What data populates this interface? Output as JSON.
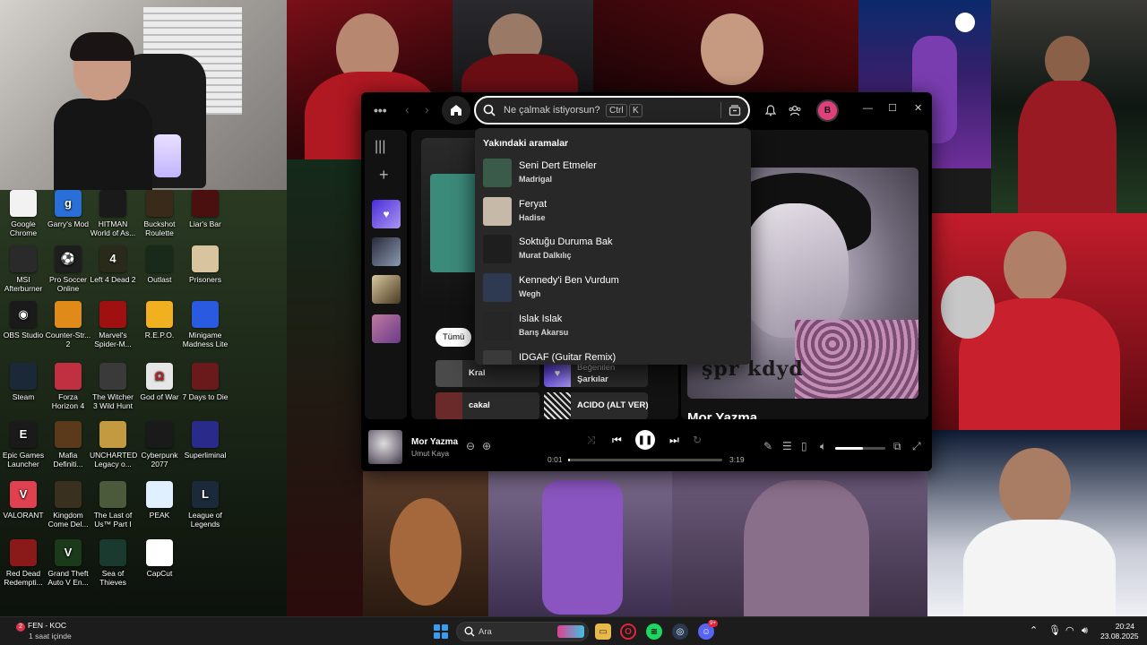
{
  "spotify": {
    "search": {
      "placeholder": "Ne çalmak istiyorsun?",
      "kbd1": "Ctrl",
      "kbd2": "K"
    },
    "avatar_letter": "B",
    "recent_header": "Yakındaki aramalar",
    "recent": [
      {
        "title": "Seni Dert Etmeler",
        "artist": "Madrigal",
        "color": "#3a5a4a"
      },
      {
        "title": "Feryat",
        "artist": "Hadise",
        "color": "#c7b9a8"
      },
      {
        "title": "Soktuğu Duruma Bak",
        "artist": "Murat Dalkılıç",
        "color": "#1e1e1e"
      },
      {
        "title": "Kennedy'i Ben Vurdum",
        "artist": "Wegh",
        "color": "#2e3a52"
      },
      {
        "title": "Islak Islak",
        "artist": "Barış Akarsu",
        "color": "#262626"
      },
      {
        "title": "IDGAF (Guitar Remix)",
        "artist": "",
        "color": "#3a3a3a"
      }
    ],
    "filter_chip": "Tümü",
    "cards": [
      {
        "label": "Kral",
        "color": "#4a4a4a"
      },
      {
        "label": "Beğenilen",
        "label2": "Şarkılar",
        "color": "#6c4bd8"
      },
      {
        "label": "cakal",
        "color": "#6a2a2a"
      },
      {
        "label": "ACIDO (ALT VER)",
        "color": "#3a3a3a"
      }
    ],
    "now_playing_title": "Mor Yazma",
    "cover_tag": "şpr kdyd",
    "player": {
      "title": "Mor Yazma",
      "artist": "Umut Kaya",
      "elapsed": "0:01",
      "duration": "3:19",
      "progress_fraction": 0.01,
      "volume_fraction": 0.55
    },
    "accent_color": "#1ed760"
  },
  "desktop_icons": [
    {
      "label": "Google Chrome",
      "bg": "#f2f2f2",
      "glyph": "",
      "col": 0,
      "row": 0
    },
    {
      "label": "Garry's Mod",
      "bg": "#2a6fd8",
      "glyph": "g",
      "col": 1,
      "row": 0
    },
    {
      "label": "HITMAN World of As...",
      "bg": "#1a1a1a",
      "glyph": "",
      "col": 2,
      "row": 0
    },
    {
      "label": "Buckshot Roulette",
      "bg": "#3a2a1a",
      "glyph": "",
      "col": 3,
      "row": 0
    },
    {
      "label": "Liar's Bar",
      "bg": "#4a1010",
      "glyph": "",
      "col": 4,
      "row": 0
    },
    {
      "label": "MSI Afterburner",
      "bg": "#2a2a2a",
      "glyph": "",
      "col": 0,
      "row": 1
    },
    {
      "label": "Pro Soccer Online",
      "bg": "#1e1e1e",
      "glyph": "⚽",
      "col": 1,
      "row": 1
    },
    {
      "label": "Left 4 Dead 2",
      "bg": "#2a2a1a",
      "glyph": "4",
      "col": 2,
      "row": 1
    },
    {
      "label": "Outlast",
      "bg": "#1a2a1a",
      "glyph": "",
      "col": 3,
      "row": 1
    },
    {
      "label": "Prisoners",
      "bg": "#d9c4a0",
      "glyph": "",
      "col": 4,
      "row": 1
    },
    {
      "label": "OBS Studio",
      "bg": "#1a1a1a",
      "glyph": "◉",
      "col": 0,
      "row": 2
    },
    {
      "label": "Counter-Str... 2",
      "bg": "#e08a1a",
      "glyph": "",
      "col": 1,
      "row": 2
    },
    {
      "label": "Marvel's Spider-M...",
      "bg": "#a01010",
      "glyph": "",
      "col": 2,
      "row": 2
    },
    {
      "label": "R.E.P.O.",
      "bg": "#f0b020",
      "glyph": "",
      "col": 3,
      "row": 2
    },
    {
      "label": "Minigame Madness Lite",
      "bg": "#2a5ae0",
      "glyph": "",
      "col": 4,
      "row": 2
    },
    {
      "label": "Steam",
      "bg": "#1b2838",
      "glyph": "",
      "col": 0,
      "row": 3
    },
    {
      "label": "Forza Horizon 4",
      "bg": "#c03040",
      "glyph": "",
      "col": 1,
      "row": 3
    },
    {
      "label": "The Witcher 3 Wild Hunt",
      "bg": "#3a3a3a",
      "glyph": "",
      "col": 2,
      "row": 3
    },
    {
      "label": "God of War",
      "bg": "#e6e6e6",
      "glyph": "Ω",
      "col": 3,
      "row": 3
    },
    {
      "label": "7 Days to Die",
      "bg": "#6a1a1a",
      "glyph": "",
      "col": 4,
      "row": 3
    },
    {
      "label": "Epic Games Launcher",
      "bg": "#1a1a1a",
      "glyph": "E",
      "col": 0,
      "row": 4
    },
    {
      "label": "Mafia Definiti...",
      "bg": "#5a3a1a",
      "glyph": "",
      "col": 1,
      "row": 4
    },
    {
      "label": "UNCHARTED Legacy o...",
      "bg": "#c49a40",
      "glyph": "",
      "col": 2,
      "row": 4
    },
    {
      "label": "Cyberpunk 2077",
      "bg": "#1a1a1a",
      "glyph": "",
      "col": 3,
      "row": 4
    },
    {
      "label": "Superliminal",
      "bg": "#2a2a8a",
      "glyph": "",
      "col": 4,
      "row": 4
    },
    {
      "label": "VALORANT",
      "bg": "#e04050",
      "glyph": "V",
      "col": 0,
      "row": 5
    },
    {
      "label": "Kingdom Come Del...",
      "bg": "#3a3020",
      "glyph": "",
      "col": 1,
      "row": 5
    },
    {
      "label": "The Last of Us™ Part I",
      "bg": "#4a5a3a",
      "glyph": "",
      "col": 2,
      "row": 5
    },
    {
      "label": "PEAK",
      "bg": "#e0f0ff",
      "glyph": "",
      "col": 3,
      "row": 5
    },
    {
      "label": "League of Legends",
      "bg": "#1a2a3a",
      "glyph": "L",
      "col": 4,
      "row": 5
    },
    {
      "label": "Red Dead Redempti...",
      "bg": "#8a1a1a",
      "glyph": "",
      "col": 0,
      "row": 6
    },
    {
      "label": "Grand Theft Auto V En...",
      "bg": "#1a3a1a",
      "glyph": "V",
      "col": 1,
      "row": 6
    },
    {
      "label": "Sea of Thieves",
      "bg": "#1a3a30",
      "glyph": "",
      "col": 2,
      "row": 6
    },
    {
      "label": "CapCut",
      "bg": "#ffffff",
      "glyph": "",
      "col": 3,
      "row": 6
    }
  ],
  "taskbar": {
    "weather_title": "FEN - KOC",
    "weather_sub": "1 saat içinde",
    "weather_badge": "2",
    "search_placeholder": "Ara",
    "time": "20:24",
    "date": "23.08.2025",
    "discord_badge": "9+"
  }
}
